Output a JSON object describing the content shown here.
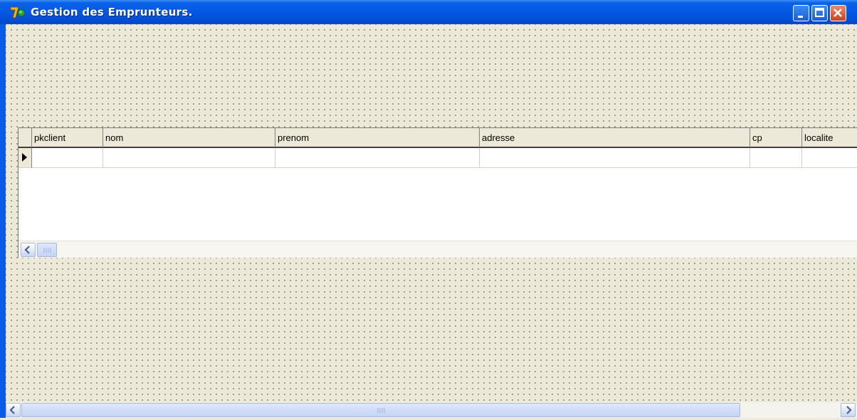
{
  "window": {
    "title": "Gestion des Emprunteurs.",
    "icons": {
      "app": "delphi-app-icon",
      "minimize": "minimize-icon",
      "maximize": "maximize-icon",
      "close": "close-icon"
    }
  },
  "grid": {
    "columns": [
      "pkclient",
      "nom",
      "prenom",
      "adresse",
      "cp",
      "localite"
    ],
    "rows": [
      [
        "",
        "",
        "",
        "",
        "",
        ""
      ]
    ],
    "row_indicator": "current-row-arrow-icon"
  },
  "colors": {
    "titlebar": "#0355e0",
    "form_background": "#ece9d8",
    "close_button": "#c9441f"
  }
}
